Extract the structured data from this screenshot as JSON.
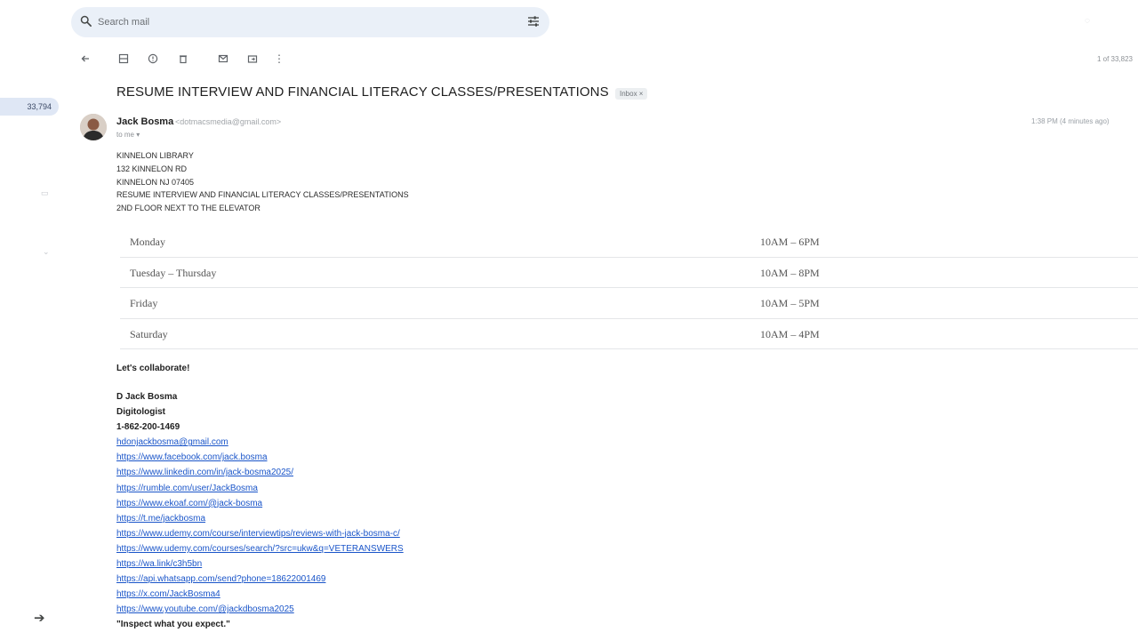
{
  "rail": {
    "badge_count": "33,794"
  },
  "search": {
    "placeholder": "Search mail"
  },
  "pager": {
    "text": "1 of 33,823"
  },
  "email": {
    "subject": "RESUME INTERVIEW AND FINANCIAL LITERACY CLASSES/PRESENTATIONS",
    "label": "Inbox",
    "sender_name": "Jack Bosma",
    "sender_email": "<dotmacsmedia@gmail.com>",
    "to_line": "to me",
    "timestamp": "1:38 PM (4 minutes ago)",
    "address_lines": [
      "KINNELON LIBRARY",
      "132 KINNELON RD",
      "KINNELON NJ 07405",
      "RESUME INTERVIEW AND FINANCIAL LITERACY CLASSES/PRESENTATIONS",
      "2ND FLOOR NEXT TO THE ELEVATOR"
    ],
    "hours": [
      {
        "day": "Monday",
        "time": "10AM – 6PM"
      },
      {
        "day": "Tuesday – Thursday",
        "time": "10AM – 8PM"
      },
      {
        "day": "Friday",
        "time": "10AM – 5PM"
      },
      {
        "day": "Saturday",
        "time": "10AM – 4PM"
      }
    ],
    "collab": "Let's collaborate!",
    "signature": {
      "name": "D Jack Bosma",
      "title": "Digitologist",
      "phone": "1-862-200-1469",
      "links": [
        "hdonjackbosma@gmail.com",
        "https://www.facebook.com/jack.bosma",
        "https://www.linkedin.com/in/jack-bosma2025/",
        "https://rumble.com/user/JackBosma",
        "https://www.ekoaf.com/@jack-bosma",
        "https://t.me/jackbosma",
        "https://www.udemy.com/course/interviewtips/reviews-with-jack-bosma-c/",
        "https://www.udemy.com/courses/search/?src=ukw&q=VETERANSWERS",
        "https://wa.link/c3h5bn",
        "https://api.whatsapp.com/send?phone=18622001469",
        "https://x.com/JackBosma4",
        "https://www.youtube.com/@jackdbosma2025"
      ],
      "quote": "\"Inspect what you expect.\""
    }
  }
}
